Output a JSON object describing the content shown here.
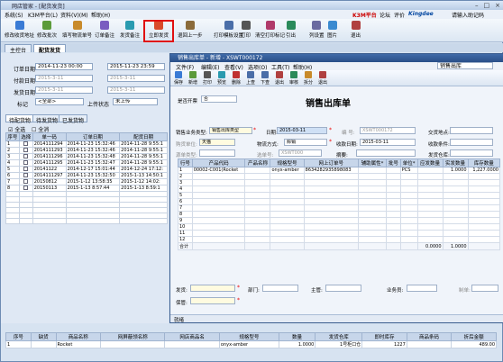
{
  "app": {
    "title": "网店管家 - [配货发货]",
    "brand_k3m": "K3M平台",
    "brand_forum": "论坛",
    "brand_review": "评价",
    "brand_kingdee": "Kingdee",
    "brand_input": "请输入助记码"
  },
  "menu": [
    "系统(S)",
    "K3M平台(L)",
    "资料(V)(M)",
    "",
    "帮助(H)"
  ],
  "toolbar": [
    "修改收货地址",
    "修改批次",
    "填写物流单号",
    "订单备注",
    "发货备注",
    "立即发货",
    "退回上一步",
    "打印模板设置",
    "打印",
    "清空打印标记",
    "引出",
    "列设置",
    "图片",
    "退出"
  ],
  "tabs": [
    "主控台",
    "配货发货"
  ],
  "filter": {
    "order_date_label": "订单日期",
    "order_date_from": "2014-11-23 00:00",
    "order_date_to": "2015-11-23 23:59",
    "pay_date_label": "付款日期",
    "pay_date_from": "2015-3-11",
    "pay_date_to": "2015-3-11",
    "ship_date_label": "发货日期",
    "ship_date_from": "2015-3-11",
    "ship_date_to": "2015-3-11",
    "mark_label": "标记",
    "mark_value": "<全部>",
    "shelf_label": "上传状态",
    "shelf_value": "未上传"
  },
  "subtabs": [
    "待配货物",
    "待发货物",
    "已发货物"
  ],
  "select_all": "全选",
  "select_clear": "全消",
  "left_grid": {
    "headers": [
      "序号",
      "选择",
      "单一码",
      "订单日期",
      "配货日期"
    ],
    "rows": [
      [
        "1",
        "",
        "2014111294",
        "2014-11-23 15:32:46",
        "2014-11-28 9:55:1"
      ],
      [
        "2",
        "",
        "2014111293",
        "2014-11-23 15:32:46",
        "2014-11-28 9:55:1"
      ],
      [
        "3",
        "",
        "2014111296",
        "2014-11-23 15:32:48",
        "2014-11-28 9:55:1"
      ],
      [
        "4",
        "",
        "2014111295",
        "2014-11-23 15:32:47",
        "2014-11-28 9:55:1"
      ],
      [
        "5",
        "",
        "20141122",
        "2014-12-17 15:01:44",
        "2014-12-24 17:12:"
      ],
      [
        "6",
        "",
        "2014111297",
        "2014-11-23 15:32:50",
        "2015-1-13 14:50:1"
      ],
      [
        "7",
        "",
        "20150812",
        "2015-1-12 13:58:35",
        "2015-1-12 14:02:"
      ],
      [
        "8",
        "",
        "20150113",
        "2015-1-13 8:57:44",
        "2015-1-13 8:59:1"
      ]
    ]
  },
  "dialog": {
    "title": "销售出库单 - 新增 - XSWT000172",
    "menu": [
      "文件(F)",
      "编辑(E)",
      "查看(V)",
      "选项(O)",
      "工具(T)",
      "帮助(H)"
    ],
    "toolbar": [
      "保存",
      "新增",
      "打印",
      "预览",
      "删除",
      "上查",
      "下查",
      "退出",
      "审核",
      "拆分",
      "退出"
    ],
    "type_value": "销售出库",
    "doc_title": "销售出库单",
    "seal_label": "是否开票",
    "seal_value": "否",
    "biz_type_label": "销售业务类型:",
    "biz_type_value": "销售出库类型",
    "date_label": "日期:",
    "date_value": "2015-03-11",
    "number_label": "编 号:",
    "number_value": "XSWT000172",
    "trade_label": "交货地点:",
    "ship_mode_label": "物流方式:",
    "ship_mode_value": "赊销",
    "receipt_date_label": "收款日期:",
    "receipt_date_value": "2015-03-11",
    "terms_label": "收款条件:",
    "pay_type_label": "购货单位:",
    "pay_type_value": "天猫",
    "source_type_label": "源单类型:",
    "source_no_label": "选单号:",
    "source_no_value": "XSWT000",
    "remark_label": "摘要:",
    "ship_store_label": "发货仓库:",
    "grid_headers": [
      "行号",
      "产品代码",
      "产品名称",
      "规格型号",
      "网上订单号",
      "辅助属性*",
      "批号",
      "单位*",
      "应发数量",
      "实发数量",
      "库存数量"
    ],
    "grid_rows": [
      [
        "1",
        "00002-C001(Rocket",
        "",
        "onyx-amber",
        "8634282935898083",
        "",
        "",
        "PCS",
        "",
        "1.0000",
        "1,227.0000"
      ],
      [
        "2",
        "",
        "",
        "",
        "",
        "",
        "",
        "",
        "",
        "",
        ""
      ],
      [
        "3",
        "",
        "",
        "",
        "",
        "",
        "",
        "",
        "",
        "",
        ""
      ],
      [
        "4",
        "",
        "",
        "",
        "",
        "",
        "",
        "",
        "",
        "",
        ""
      ],
      [
        "5",
        "",
        "",
        "",
        "",
        "",
        "",
        "",
        "",
        "",
        ""
      ],
      [
        "6",
        "",
        "",
        "",
        "",
        "",
        "",
        "",
        "",
        "",
        ""
      ],
      [
        "7",
        "",
        "",
        "",
        "",
        "",
        "",
        "",
        "",
        "",
        ""
      ],
      [
        "8",
        "",
        "",
        "",
        "",
        "",
        "",
        "",
        "",
        "",
        ""
      ],
      [
        "9",
        "",
        "",
        "",
        "",
        "",
        "",
        "",
        "",
        "",
        ""
      ],
      [
        "10",
        "",
        "",
        "",
        "",
        "",
        "",
        "",
        "",
        "",
        ""
      ],
      [
        "11",
        "",
        "",
        "",
        "",
        "",
        "",
        "",
        "",
        "",
        ""
      ],
      [
        "12",
        "",
        "",
        "",
        "",
        "",
        "",
        "",
        "",
        "",
        ""
      ]
    ],
    "sum_label": "合计",
    "sum_values": [
      "0.0000",
      "1.0000",
      ""
    ],
    "bottom": {
      "ship_label": "发货:",
      "dept_label": "部门:",
      "mgr_label": "主管:",
      "sales_label": "业务员:",
      "maker_label": "制单:",
      "maker_value": "",
      "keeper_label": "保管:"
    },
    "status": "就绪"
  },
  "bottom_grid": {
    "headers": [
      "序号",
      "缺货",
      "商品名称",
      "网屏蔽领名称",
      "网店商品名",
      "规格型号",
      "数量",
      "发货仓库",
      "即时库存",
      "商品条码",
      "折后金额"
    ],
    "rows": [
      [
        "1",
        "",
        "Rocket",
        "",
        "",
        "onyx-amber",
        "1.0000",
        "1号柜口仓",
        "1227",
        "",
        "489.00"
      ]
    ]
  },
  "colors": {
    "accent": "#2a4f88",
    "highlight": "#e01010"
  }
}
